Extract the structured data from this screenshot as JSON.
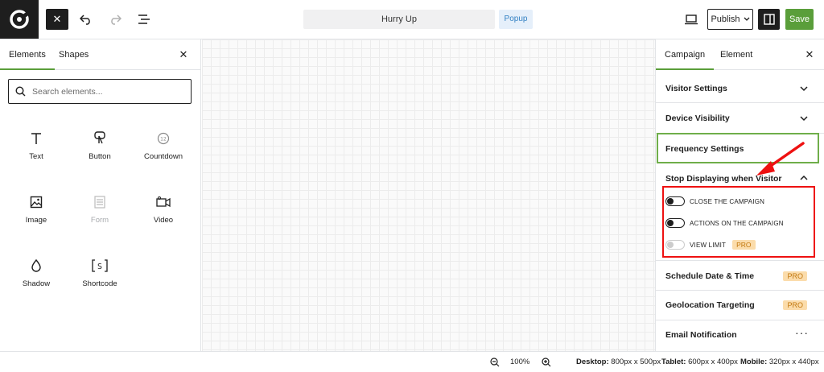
{
  "header": {
    "close_label": "✕",
    "campaign_title": "Hurry Up",
    "campaign_type": "Popup",
    "publish_label": "Publish",
    "save_label": "Save"
  },
  "left_panel": {
    "tabs": [
      "Elements",
      "Shapes"
    ],
    "close_label": "✕",
    "search_placeholder": "Search elements...",
    "elements": [
      {
        "label": "Text",
        "icon": "text-icon",
        "disabled": false
      },
      {
        "label": "Button",
        "icon": "button-icon",
        "disabled": false
      },
      {
        "label": "Countdown",
        "icon": "countdown-icon",
        "disabled": false
      },
      {
        "label": "Image",
        "icon": "image-icon",
        "disabled": false
      },
      {
        "label": "Form",
        "icon": "form-icon",
        "disabled": true
      },
      {
        "label": "Video",
        "icon": "video-icon",
        "disabled": false
      },
      {
        "label": "Shadow",
        "icon": "shadow-icon",
        "disabled": false
      },
      {
        "label": "Shortcode",
        "icon": "shortcode-icon",
        "disabled": false
      }
    ]
  },
  "right_panel": {
    "tabs": [
      "Campaign",
      "Element"
    ],
    "close_label": "✕",
    "sections": {
      "visitor_settings": "Visitor Settings",
      "device_visibility": "Device Visibility",
      "frequency_settings": "Frequency Settings",
      "stop_displaying": "Stop Displaying when Visitor",
      "schedule": "Schedule Date & Time",
      "geolocation": "Geolocation Targeting",
      "email_notification": "Email Notification"
    },
    "toggles": [
      {
        "label": "CLOSE THE CAMPAIGN",
        "on": false,
        "disabled": false
      },
      {
        "label": "ACTIONS ON THE CAMPAIGN",
        "on": false,
        "disabled": false
      },
      {
        "label": "VIEW LIMIT",
        "on": false,
        "disabled": true
      }
    ],
    "pro_badge": "PRO",
    "more_label": "···"
  },
  "status_bar": {
    "zoom": "100%",
    "desktop_label": "Desktop:",
    "desktop_value": "800px x 500px",
    "tablet_label": "Tablet:",
    "tablet_value": "600px x 400px",
    "mobile_label": "Mobile:",
    "mobile_value": "320px x 440px"
  },
  "colors": {
    "accent": "#5a9e3a",
    "dark": "#1e1e1e",
    "highlight_red": "#e11111",
    "pro_bg": "#fbdcab"
  }
}
